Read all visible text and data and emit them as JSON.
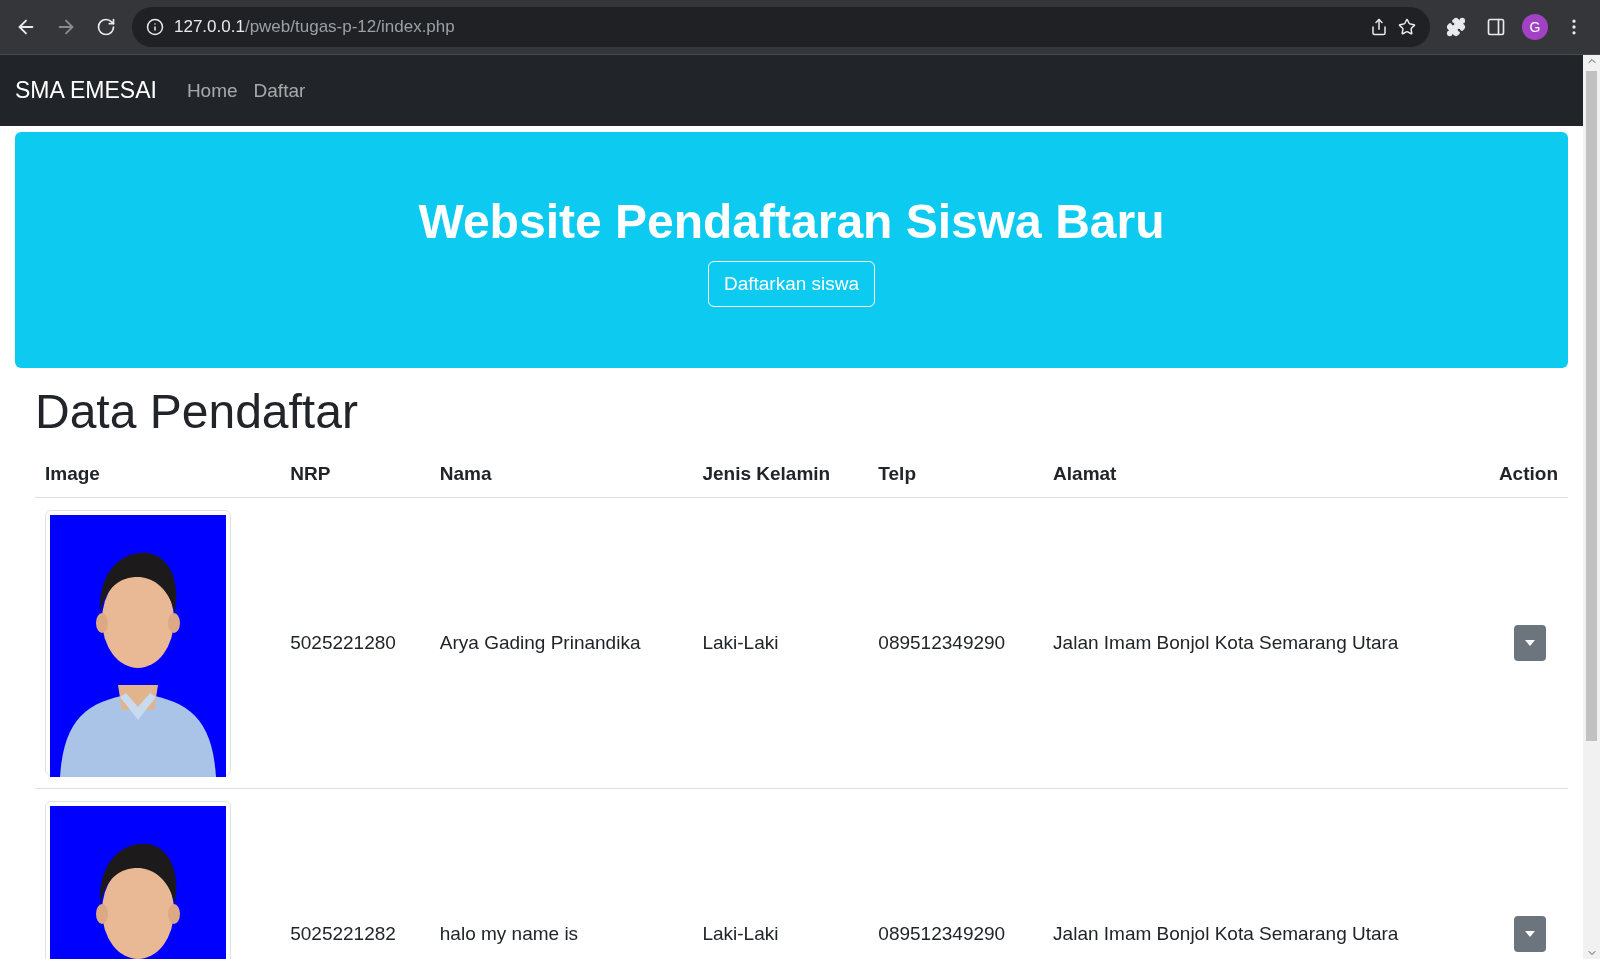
{
  "browser": {
    "url_host": "127.0.0.1",
    "url_path": "/pweb/tugas-p-12/index.php",
    "profile_initial": "G"
  },
  "navbar": {
    "brand": "SMA EMESAI",
    "links": [
      {
        "label": "Home"
      },
      {
        "label": "Daftar"
      }
    ]
  },
  "hero": {
    "title": "Website Pendaftaran Siswa Baru",
    "button": "Daftarkan siswa"
  },
  "section_title": "Data Pendaftar",
  "table": {
    "columns": [
      "Image",
      "NRP",
      "Nama",
      "Jenis Kelamin",
      "Telp",
      "Alamat",
      "Action"
    ],
    "rows": [
      {
        "nrp": "5025221280",
        "nama": "Arya Gading Prinandika",
        "jenis_kelamin": "Laki-Laki",
        "telp": "089512349290",
        "alamat": "Jalan Imam Bonjol Kota Semarang Utara"
      },
      {
        "nrp": "5025221282",
        "nama": "halo my name is",
        "jenis_kelamin": "Laki-Laki",
        "telp": "089512349290",
        "alamat": "Jalan Imam Bonjol Kota Semarang Utara"
      }
    ]
  }
}
